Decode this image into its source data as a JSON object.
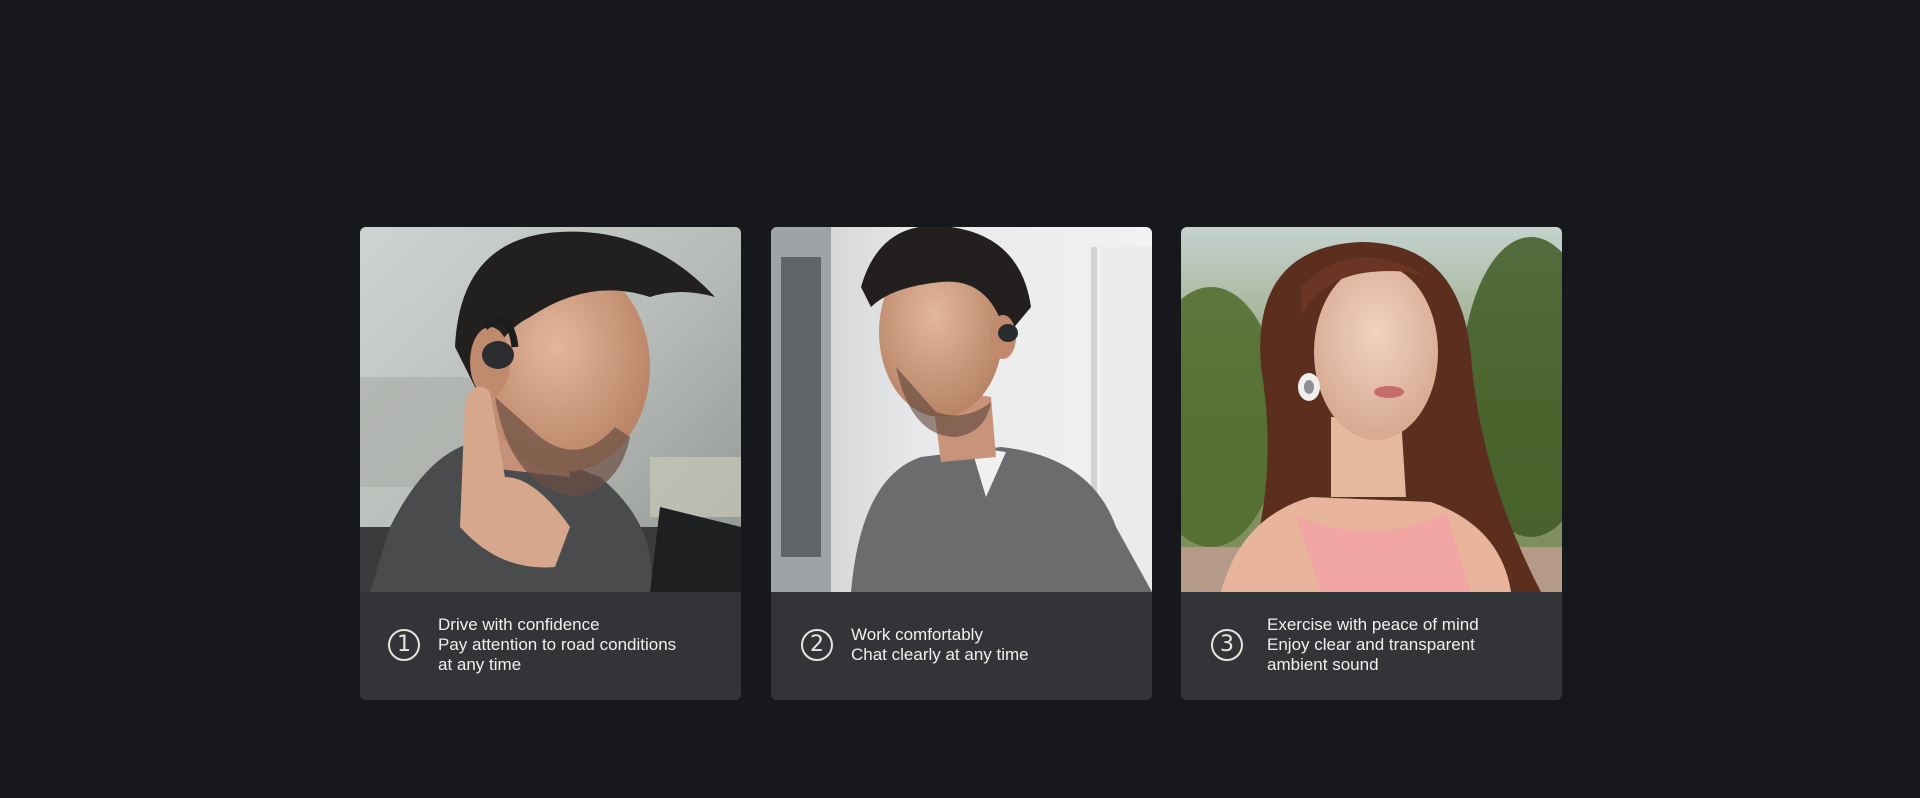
{
  "cards": [
    {
      "number": "1",
      "title": "Drive with confidence",
      "line2": "Pay attention to road conditions",
      "line3": "at any time"
    },
    {
      "number": "2",
      "title": "Work comfortably",
      "line2": "Chat clearly at any time"
    },
    {
      "number": "3",
      "title": "Exercise with peace of mind",
      "line2": "Enjoy clear and transparent",
      "line3": "ambient sound"
    }
  ],
  "colors": {
    "background": "#17181c",
    "card": "#333438",
    "text": "#f1f0ec"
  }
}
